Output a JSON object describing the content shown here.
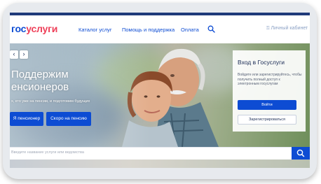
{
  "header": {
    "logo_part1": "гос",
    "logo_part2": "услуги",
    "nav": [
      {
        "label": "Каталог услуг"
      },
      {
        "label": "Помощь и поддержка"
      },
      {
        "label": "Оплата"
      }
    ],
    "login_label": "Личный кабинет"
  },
  "hero": {
    "prev_label": "‹",
    "next_label": "›",
    "title_line1": "Поддержим",
    "title_line2": "енсионеров",
    "subtitle": "х, кто уже на пенсии, и подготовим будущих",
    "btn_pensioner": "Я пенсионер",
    "btn_soon": "Скоро на пенсию"
  },
  "auth": {
    "title": "Вход в Госуслуги",
    "text": "Войдите или зарегистрируйтесь, чтобы получить полный доступ к электронным госуслугам",
    "login_button": "Войти",
    "register_button": "Зарегистрироваться"
  },
  "search": {
    "placeholder": "Введите название услуги или ведомства"
  },
  "colors": {
    "brand_blue": "#0d4cd3",
    "brand_red": "#ee3f58",
    "top_bar": "#1f3a7a"
  }
}
